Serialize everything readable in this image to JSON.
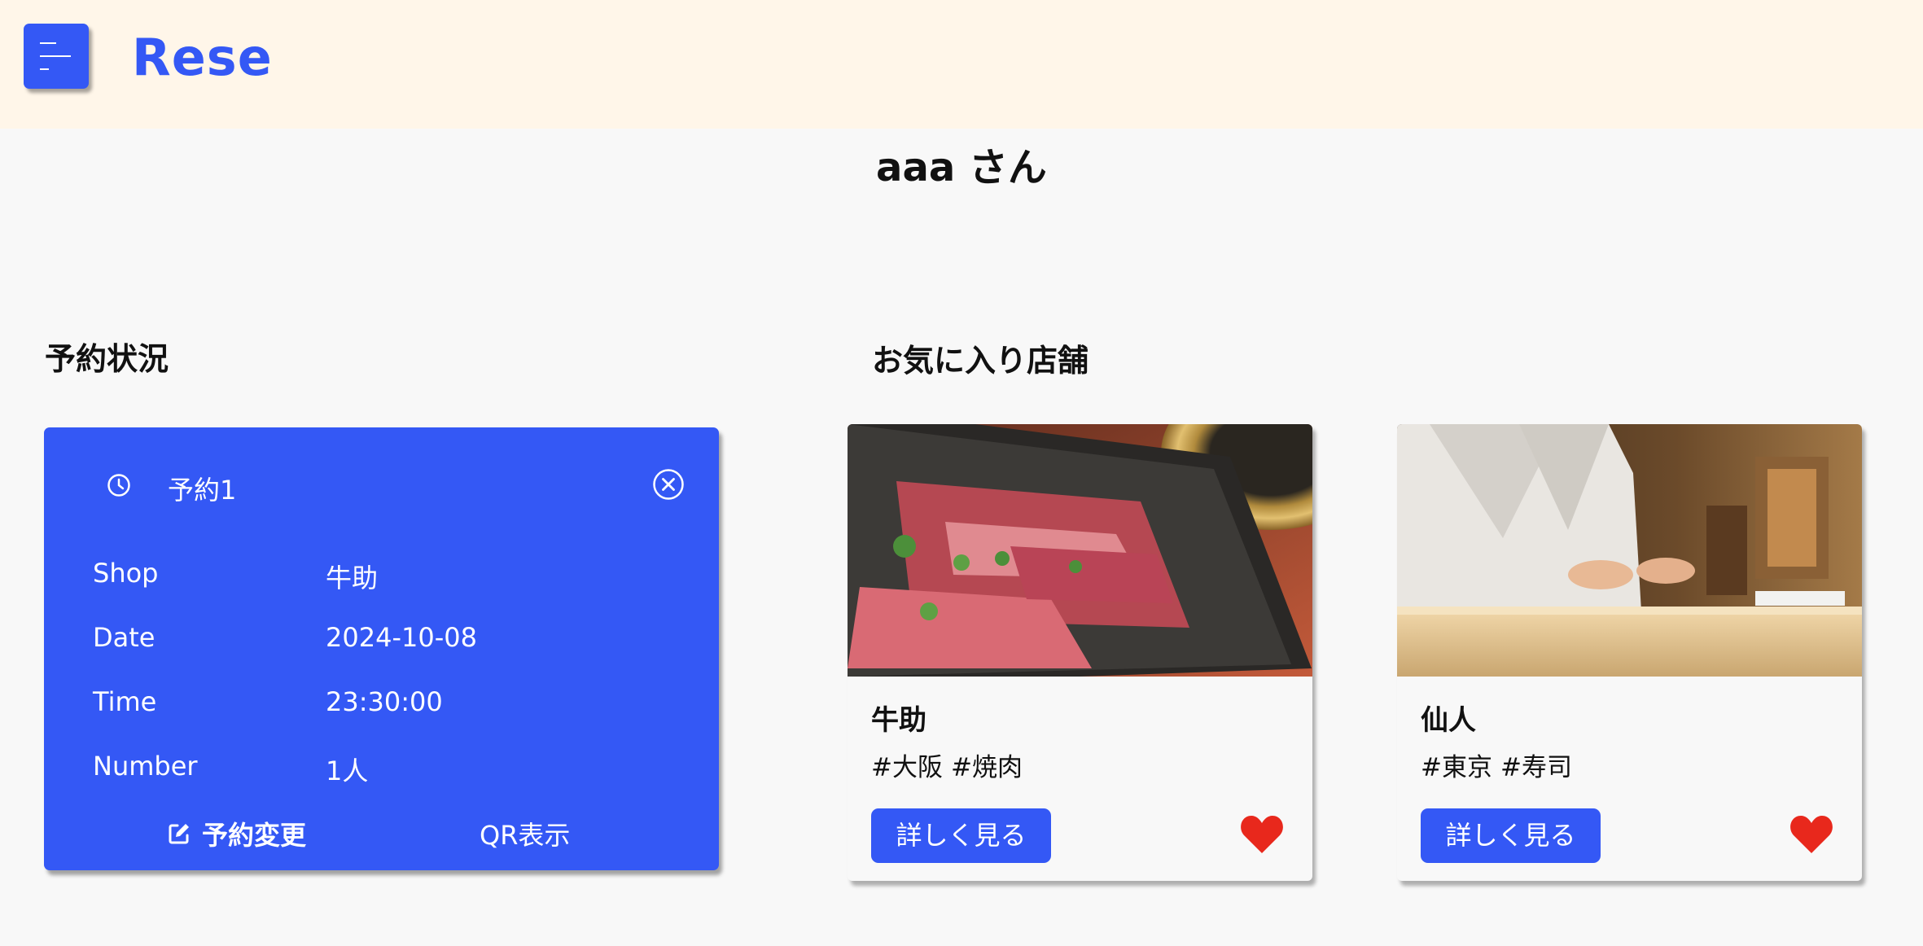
{
  "header": {
    "logo": "Rese",
    "menu_icon": "hamburger-menu-icon",
    "accent_color": "#3458f5",
    "background_color": "#fff6e9"
  },
  "greeting": "aaa さん",
  "reservations": {
    "section_title": "予約状況",
    "items": [
      {
        "title": "予約1",
        "icon": "clock-icon",
        "close_icon": "close-circle-icon",
        "rows": [
          {
            "label": "Shop",
            "value": "牛助"
          },
          {
            "label": "Date",
            "value": "2024-10-08"
          },
          {
            "label": "Time",
            "value": "23:30:00"
          },
          {
            "label": "Number",
            "value": "1人"
          }
        ],
        "edit_label": "予約変更",
        "edit_icon": "edit-icon",
        "qr_label": "QR表示"
      }
    ]
  },
  "favorites": {
    "section_title": "お気に入り店舗",
    "shops": [
      {
        "name": "牛助",
        "tags": [
          "#大阪",
          "#焼肉"
        ],
        "button_label": "詳しく見る",
        "favorite_icon": "heart-icon",
        "favorite_color": "#e8281c",
        "image": "yakiniku-photo"
      },
      {
        "name": "仙人",
        "tags": [
          "#東京",
          "#寿司"
        ],
        "button_label": "詳しく見る",
        "favorite_icon": "heart-icon",
        "favorite_color": "#e8281c",
        "image": "sushi-chef-photo"
      }
    ]
  }
}
